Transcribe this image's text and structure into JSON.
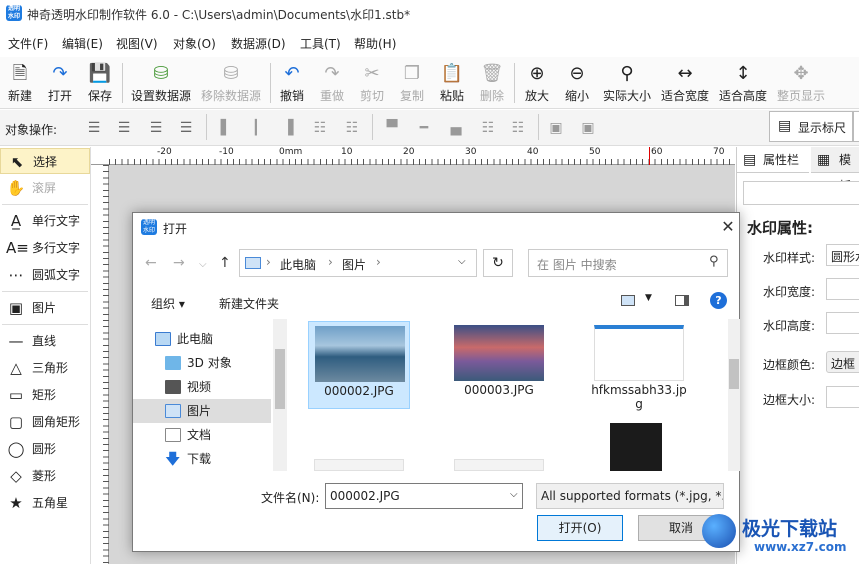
{
  "window": {
    "title": "神奇透明水印制作软件 6.0 - C:\\Users\\admin\\Documents\\水印1.stb*",
    "icon_text": "透明水印"
  },
  "menu": [
    "文件(F)",
    "编辑(E)",
    "视图(V)",
    "对象(O)",
    "数据源(D)",
    "工具(T)",
    "帮助(H)"
  ],
  "toolbar": {
    "new": "新建",
    "open": "打开",
    "save": "保存",
    "set_ds": "设置数据源",
    "remove_ds": "移除数据源",
    "undo": "撤销",
    "redo": "重做",
    "cut": "剪切",
    "copy": "复制",
    "paste": "粘贴",
    "delete": "删除",
    "zoom_in": "放大",
    "zoom_out": "缩小",
    "actual": "实际大小",
    "fit_w": "适合宽度",
    "fit_h": "适合高度",
    "page": "整页显示"
  },
  "objbar": {
    "label": "对象操作:",
    "show_ruler": "显示标尺"
  },
  "tools": {
    "select": "选择",
    "scroll": "滚屏",
    "single_text": "单行文字",
    "multi_text": "多行文字",
    "arc_text": "圆弧文字",
    "image": "图片",
    "line": "直线",
    "triangle": "三角形",
    "rect": "矩形",
    "round_rect": "圆角矩形",
    "circle": "圆形",
    "diamond": "菱形",
    "star": "五角星"
  },
  "ruler": {
    "marks": [
      "-20",
      "-10",
      "0mm",
      "10",
      "20",
      "30",
      "40",
      "50",
      "60",
      "70"
    ]
  },
  "right": {
    "tab_props": "属性栏",
    "tab_template": "模板",
    "heading": "水印属性:",
    "style_label": "水印样式:",
    "style_value": "圆形水",
    "width_label": "水印宽度:",
    "height_label": "水印高度:",
    "border_color_label": "边框颜色:",
    "border_color_value": "边框",
    "border_size_label": "边框大小:"
  },
  "dialog": {
    "title": "打开",
    "breadcrumb": [
      "此电脑",
      "图片"
    ],
    "search_placeholder": "在 图片 中搜索",
    "organize": "组织 ▾",
    "new_folder": "新建文件夹",
    "tree": [
      "此电脑",
      "3D 对象",
      "视频",
      "图片",
      "文档",
      "下载"
    ],
    "files": [
      "000002.JPG",
      "000003.JPG",
      "hfkmssabh33.jpg"
    ],
    "filename_label": "文件名(N):",
    "filename_value": "000002.JPG",
    "filetype": "All supported formats (*.jpg, *.",
    "open_button": "打开(O)",
    "cancel_button": "取消"
  },
  "watermark_site": {
    "line1": "极光下载站",
    "line2": "www.xz7.com"
  }
}
